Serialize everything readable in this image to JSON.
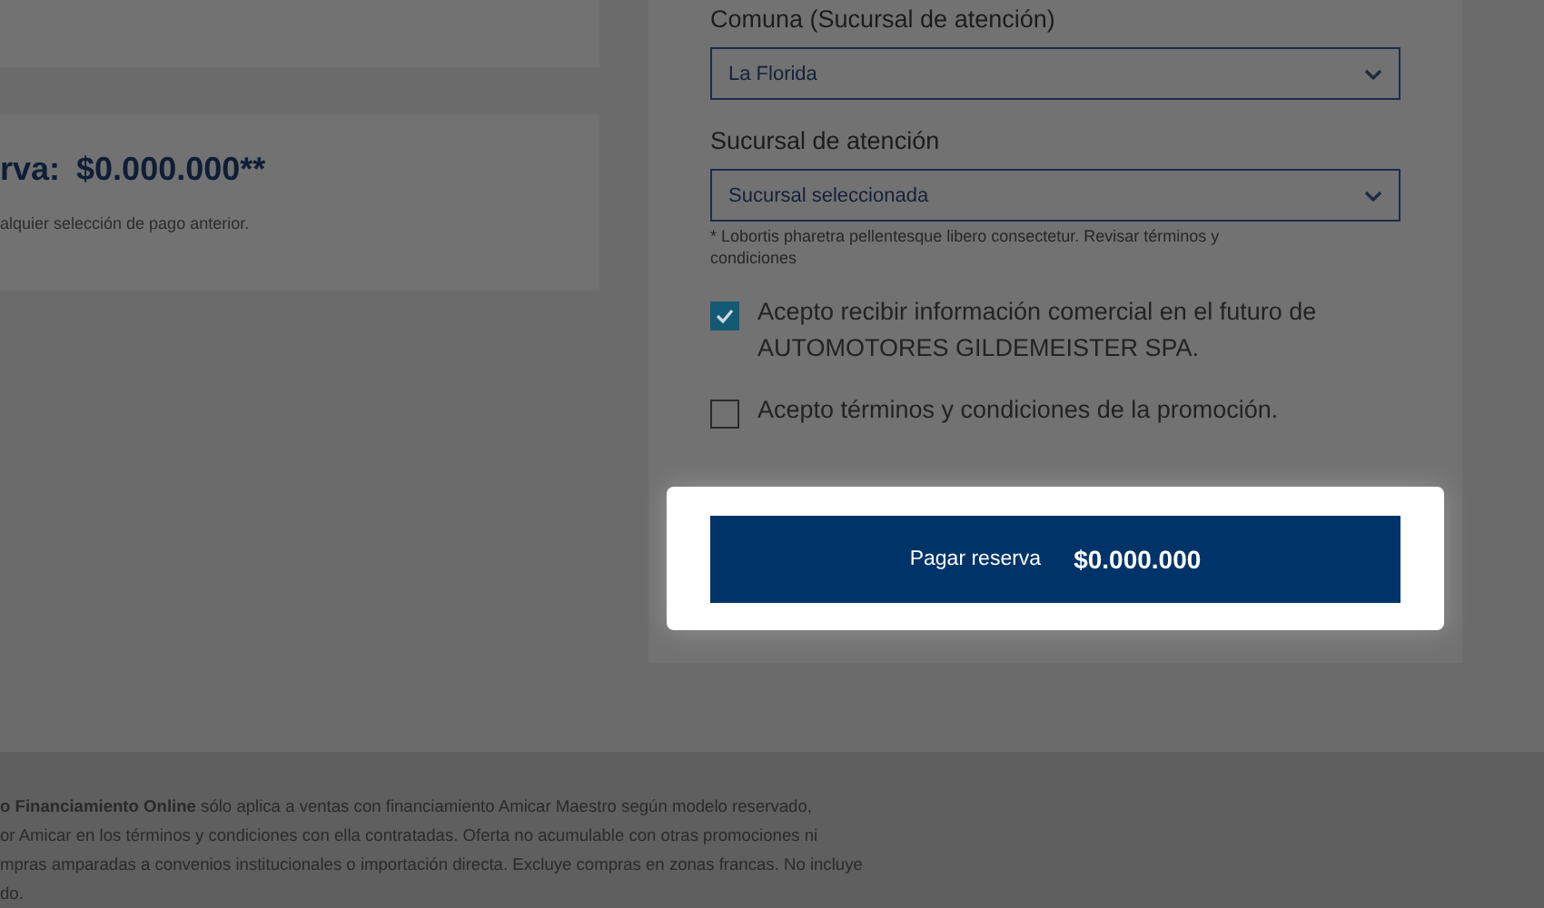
{
  "summary": {
    "total_label": "rva:",
    "total_value": "$0.000.000**",
    "note": "alquier selección de pago anterior."
  },
  "form": {
    "fields": [
      {
        "label": "Comuna (Sucursal de atención)",
        "value": "La Florida"
      },
      {
        "label": "Sucursal de atención",
        "value": "Sucursal seleccionada"
      }
    ],
    "hint": "* Lobortis pharetra pellentesque libero consectetur. Revisar términos y condiciones",
    "checkboxes": [
      {
        "label": "Acepto recibir información comercial en el futuro de AUTOMOTORES GILDEMEISTER SPA.",
        "checked": true
      },
      {
        "label": "Acepto términos y condiciones de la promoción.",
        "checked": false
      }
    ],
    "pay_button": {
      "label": "Pagar reserva",
      "amount": "$0.000.000"
    }
  },
  "footer": {
    "lines": [
      "**o Financiamiento Online** sólo aplica a ventas con financiamiento Amicar Maestro según modelo reservado,",
      "or Amicar en los términos y condiciones con ella contratadas. Oferta no acumulable con otras promociones ni",
      "mpras amparadas a convenios institucionales o importación directa. Excluye compras en zonas francas. No incluye",
      "do."
    ]
  }
}
